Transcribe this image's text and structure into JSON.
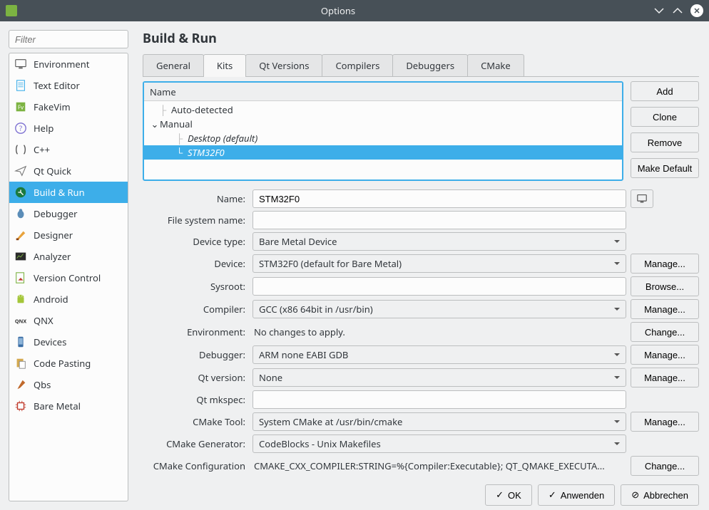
{
  "window": {
    "title": "Options"
  },
  "filter": {
    "placeholder": "Filter"
  },
  "categories": [
    {
      "label": "Environment"
    },
    {
      "label": "Text Editor"
    },
    {
      "label": "FakeVim"
    },
    {
      "label": "Help"
    },
    {
      "label": "C++"
    },
    {
      "label": "Qt Quick"
    },
    {
      "label": "Build & Run"
    },
    {
      "label": "Debugger"
    },
    {
      "label": "Designer"
    },
    {
      "label": "Analyzer"
    },
    {
      "label": "Version Control"
    },
    {
      "label": "Android"
    },
    {
      "label": "QNX"
    },
    {
      "label": "Devices"
    },
    {
      "label": "Code Pasting"
    },
    {
      "label": "Qbs"
    },
    {
      "label": "Bare Metal"
    }
  ],
  "page": {
    "title": "Build & Run"
  },
  "tabs": [
    {
      "label": "General"
    },
    {
      "label": "Kits"
    },
    {
      "label": "Qt Versions"
    },
    {
      "label": "Compilers"
    },
    {
      "label": "Debuggers"
    },
    {
      "label": "CMake"
    }
  ],
  "tree": {
    "header": "Name",
    "auto": "Auto-detected",
    "manual": "Manual",
    "items": [
      {
        "label": "Desktop (default)"
      },
      {
        "label": "STM32F0"
      }
    ]
  },
  "side_buttons": {
    "add": "Add",
    "clone": "Clone",
    "remove": "Remove",
    "make_default": "Make Default"
  },
  "form": {
    "name_label": "Name:",
    "name_value": "STM32F0",
    "fsname_label": "File system name:",
    "fsname_value": "",
    "devtype_label": "Device type:",
    "devtype_value": "Bare Metal Device",
    "device_label": "Device:",
    "device_value": "STM32F0 (default for Bare Metal)",
    "sysroot_label": "Sysroot:",
    "sysroot_value": "",
    "compiler_label": "Compiler:",
    "compiler_value": "GCC (x86 64bit in /usr/bin)",
    "env_label": "Environment:",
    "env_value": "No changes to apply.",
    "debugger_label": "Debugger:",
    "debugger_value": "ARM none EABI GDB",
    "qtver_label": "Qt version:",
    "qtver_value": "None",
    "mkspec_label": "Qt mkspec:",
    "mkspec_value": "",
    "cmaketool_label": "CMake Tool:",
    "cmaketool_value": "System CMake at /usr/bin/cmake",
    "cmakegen_label": "CMake Generator:",
    "cmakegen_value": "CodeBlocks - Unix Makefiles",
    "cmakecfg_label": "CMake Configuration",
    "cmakecfg_value": "CMAKE_CXX_COMPILER:STRING=%{Compiler:Executable}; QT_QMAKE_EXECUTA..."
  },
  "action_buttons": {
    "manage": "Manage...",
    "browse": "Browse...",
    "change": "Change..."
  },
  "dialog": {
    "ok": "OK",
    "apply": "Anwenden",
    "cancel": "Abbrechen"
  }
}
